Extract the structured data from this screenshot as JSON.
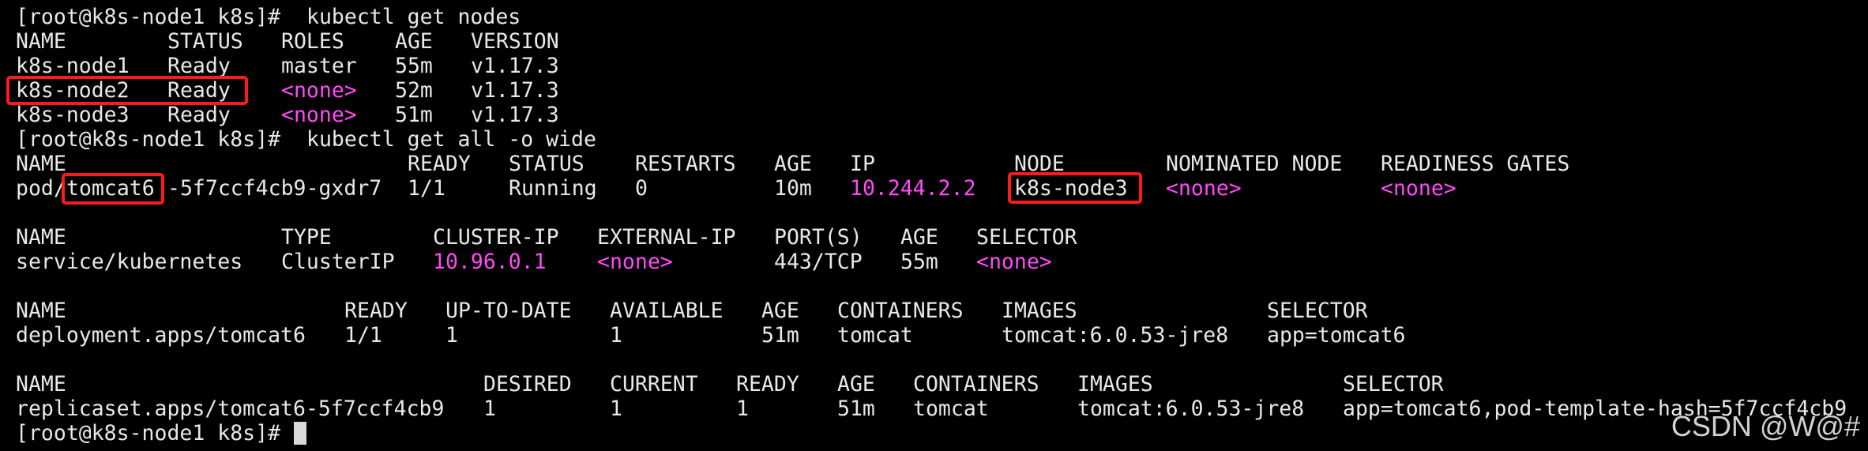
{
  "terminal": {
    "prompt": "[root@k8s-node1 k8s]#",
    "cmd1": "kubectl get nodes",
    "nodes": {
      "headers": [
        "NAME",
        "STATUS",
        "ROLES",
        "AGE",
        "VERSION"
      ],
      "rows": [
        [
          "k8s-node1",
          "Ready",
          "master",
          "55m",
          "v1.17.3"
        ],
        [
          "k8s-node2",
          "Ready",
          "<none>",
          "52m",
          "v1.17.3"
        ],
        [
          "k8s-node3",
          "Ready",
          "<none>",
          "51m",
          "v1.17.3"
        ]
      ]
    },
    "cmd2": "kubectl get all -o wide",
    "pods": {
      "headers": [
        "NAME",
        "READY",
        "STATUS",
        "RESTARTS",
        "AGE",
        "IP",
        "NODE",
        "NOMINATED NODE",
        "READINESS GATES"
      ],
      "row": {
        "prefix": "pod/",
        "app": "tomcat6",
        "suffix": "-5f7ccf4cb9-gxdr7",
        "ready": "1/1",
        "status": "Running",
        "restarts": "0",
        "age": "10m",
        "ip": "10.244.2.2",
        "node": "k8s-node3",
        "nominated": "<none>",
        "gates": "<none>"
      }
    },
    "services": {
      "headers": [
        "NAME",
        "TYPE",
        "CLUSTER-IP",
        "EXTERNAL-IP",
        "PORT(S)",
        "AGE",
        "SELECTOR"
      ],
      "row": [
        "service/kubernetes",
        "ClusterIP",
        "10.96.0.1",
        "<none>",
        "443/TCP",
        "55m",
        "<none>"
      ]
    },
    "deployments": {
      "headers": [
        "NAME",
        "READY",
        "UP-TO-DATE",
        "AVAILABLE",
        "AGE",
        "CONTAINERS",
        "IMAGES",
        "SELECTOR"
      ],
      "row": [
        "deployment.apps/tomcat6",
        "1/1",
        "1",
        "1",
        "51m",
        "tomcat",
        "tomcat:6.0.53-jre8",
        "app=tomcat6"
      ]
    },
    "replicasets": {
      "headers": [
        "NAME",
        "DESIRED",
        "CURRENT",
        "READY",
        "AGE",
        "CONTAINERS",
        "IMAGES",
        "SELECTOR"
      ],
      "row": [
        "replicaset.apps/tomcat6-5f7ccf4cb9",
        "1",
        "1",
        "1",
        "51m",
        "tomcat",
        "tomcat:6.0.53-jre8",
        "app=tomcat6,pod-template-hash=5f7ccf4cb9"
      ]
    }
  },
  "watermark": "CSDN @W@#",
  "colors": {
    "background": "#000000",
    "text": "#e8e8e8",
    "highlight": "#ff4af6",
    "annotation": "#ff1a1a"
  }
}
